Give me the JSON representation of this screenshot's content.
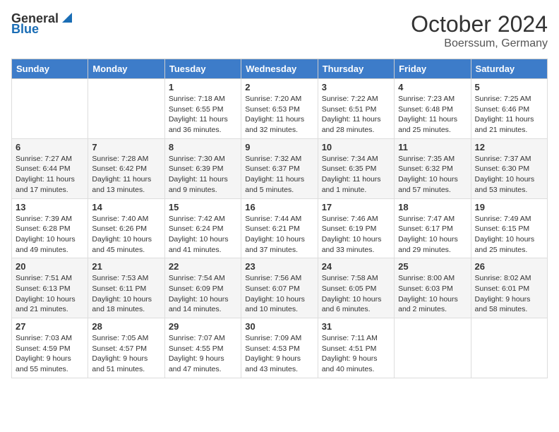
{
  "logo": {
    "general": "General",
    "blue": "Blue"
  },
  "title": "October 2024",
  "location": "Boerssum, Germany",
  "days_of_week": [
    "Sunday",
    "Monday",
    "Tuesday",
    "Wednesday",
    "Thursday",
    "Friday",
    "Saturday"
  ],
  "weeks": [
    [
      {
        "day": "",
        "detail": ""
      },
      {
        "day": "",
        "detail": ""
      },
      {
        "day": "1",
        "detail": "Sunrise: 7:18 AM\nSunset: 6:55 PM\nDaylight: 11 hours and 36 minutes."
      },
      {
        "day": "2",
        "detail": "Sunrise: 7:20 AM\nSunset: 6:53 PM\nDaylight: 11 hours and 32 minutes."
      },
      {
        "day": "3",
        "detail": "Sunrise: 7:22 AM\nSunset: 6:51 PM\nDaylight: 11 hours and 28 minutes."
      },
      {
        "day": "4",
        "detail": "Sunrise: 7:23 AM\nSunset: 6:48 PM\nDaylight: 11 hours and 25 minutes."
      },
      {
        "day": "5",
        "detail": "Sunrise: 7:25 AM\nSunset: 6:46 PM\nDaylight: 11 hours and 21 minutes."
      }
    ],
    [
      {
        "day": "6",
        "detail": "Sunrise: 7:27 AM\nSunset: 6:44 PM\nDaylight: 11 hours and 17 minutes."
      },
      {
        "day": "7",
        "detail": "Sunrise: 7:28 AM\nSunset: 6:42 PM\nDaylight: 11 hours and 13 minutes."
      },
      {
        "day": "8",
        "detail": "Sunrise: 7:30 AM\nSunset: 6:39 PM\nDaylight: 11 hours and 9 minutes."
      },
      {
        "day": "9",
        "detail": "Sunrise: 7:32 AM\nSunset: 6:37 PM\nDaylight: 11 hours and 5 minutes."
      },
      {
        "day": "10",
        "detail": "Sunrise: 7:34 AM\nSunset: 6:35 PM\nDaylight: 11 hours and 1 minute."
      },
      {
        "day": "11",
        "detail": "Sunrise: 7:35 AM\nSunset: 6:32 PM\nDaylight: 10 hours and 57 minutes."
      },
      {
        "day": "12",
        "detail": "Sunrise: 7:37 AM\nSunset: 6:30 PM\nDaylight: 10 hours and 53 minutes."
      }
    ],
    [
      {
        "day": "13",
        "detail": "Sunrise: 7:39 AM\nSunset: 6:28 PM\nDaylight: 10 hours and 49 minutes."
      },
      {
        "day": "14",
        "detail": "Sunrise: 7:40 AM\nSunset: 6:26 PM\nDaylight: 10 hours and 45 minutes."
      },
      {
        "day": "15",
        "detail": "Sunrise: 7:42 AM\nSunset: 6:24 PM\nDaylight: 10 hours and 41 minutes."
      },
      {
        "day": "16",
        "detail": "Sunrise: 7:44 AM\nSunset: 6:21 PM\nDaylight: 10 hours and 37 minutes."
      },
      {
        "day": "17",
        "detail": "Sunrise: 7:46 AM\nSunset: 6:19 PM\nDaylight: 10 hours and 33 minutes."
      },
      {
        "day": "18",
        "detail": "Sunrise: 7:47 AM\nSunset: 6:17 PM\nDaylight: 10 hours and 29 minutes."
      },
      {
        "day": "19",
        "detail": "Sunrise: 7:49 AM\nSunset: 6:15 PM\nDaylight: 10 hours and 25 minutes."
      }
    ],
    [
      {
        "day": "20",
        "detail": "Sunrise: 7:51 AM\nSunset: 6:13 PM\nDaylight: 10 hours and 21 minutes."
      },
      {
        "day": "21",
        "detail": "Sunrise: 7:53 AM\nSunset: 6:11 PM\nDaylight: 10 hours and 18 minutes."
      },
      {
        "day": "22",
        "detail": "Sunrise: 7:54 AM\nSunset: 6:09 PM\nDaylight: 10 hours and 14 minutes."
      },
      {
        "day": "23",
        "detail": "Sunrise: 7:56 AM\nSunset: 6:07 PM\nDaylight: 10 hours and 10 minutes."
      },
      {
        "day": "24",
        "detail": "Sunrise: 7:58 AM\nSunset: 6:05 PM\nDaylight: 10 hours and 6 minutes."
      },
      {
        "day": "25",
        "detail": "Sunrise: 8:00 AM\nSunset: 6:03 PM\nDaylight: 10 hours and 2 minutes."
      },
      {
        "day": "26",
        "detail": "Sunrise: 8:02 AM\nSunset: 6:01 PM\nDaylight: 9 hours and 58 minutes."
      }
    ],
    [
      {
        "day": "27",
        "detail": "Sunrise: 7:03 AM\nSunset: 4:59 PM\nDaylight: 9 hours and 55 minutes."
      },
      {
        "day": "28",
        "detail": "Sunrise: 7:05 AM\nSunset: 4:57 PM\nDaylight: 9 hours and 51 minutes."
      },
      {
        "day": "29",
        "detail": "Sunrise: 7:07 AM\nSunset: 4:55 PM\nDaylight: 9 hours and 47 minutes."
      },
      {
        "day": "30",
        "detail": "Sunrise: 7:09 AM\nSunset: 4:53 PM\nDaylight: 9 hours and 43 minutes."
      },
      {
        "day": "31",
        "detail": "Sunrise: 7:11 AM\nSunset: 4:51 PM\nDaylight: 9 hours and 40 minutes."
      },
      {
        "day": "",
        "detail": ""
      },
      {
        "day": "",
        "detail": ""
      }
    ]
  ]
}
